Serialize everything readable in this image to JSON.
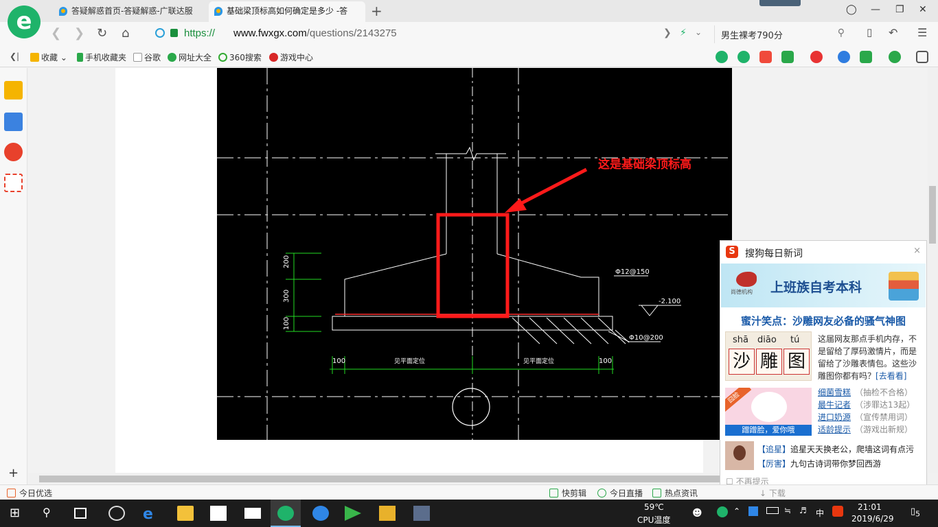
{
  "browser": {
    "tabs": [
      {
        "title": "答疑解惑首页-答疑解惑-广联达服",
        "active": false
      },
      {
        "title": "基础梁顶标高如何确定是多少 -答",
        "active": true
      }
    ],
    "url": {
      "protocol": "https://",
      "host": "www.fwxgx.com",
      "path": "/questions/2143275"
    },
    "search_query": "男生裸考790分",
    "bookmarks": [
      "收藏",
      "手机收藏夹",
      "谷歌",
      "网址大全",
      "360搜索",
      "游戏中心"
    ]
  },
  "drawing": {
    "annotation": "这是基础梁顶标高",
    "dims_left": [
      "200",
      "300",
      "100"
    ],
    "rebar_top": "Φ12@150",
    "rebar_bottom": "Φ10@200",
    "elevation": "-2.100",
    "dim_bottom": [
      "100",
      "见平面定位",
      "见平面定位",
      "100"
    ]
  },
  "popup": {
    "title": "搜狗每日新词",
    "close": "×",
    "banner_text": "上班族自考本科",
    "banner_brand": "尚德机构",
    "headline": "蜜汁笑点：沙雕网友必备的骚气神图",
    "pinyin": [
      "shā",
      "diāo",
      "tú"
    ],
    "hanzi": [
      "沙",
      "雕",
      "图"
    ],
    "body": "这届网友那点手机内存，不是留给了厚码激情片，而是留给了沙雕表情包。这些沙雕图你都有吗？",
    "more": "[去看看]",
    "img2_ribbon": "囧脸",
    "img2_caption": "蹭蹭脸，爱你哦",
    "list": [
      {
        "link": "细菌雪糕",
        "note": "（抽检不合格）"
      },
      {
        "link": "最牛记者",
        "note": "（涉罪达13起）"
      },
      {
        "link": "进口奶源",
        "note": "（宣传禁用词）"
      },
      {
        "link": "适龄提示",
        "note": "（游戏出新规）"
      }
    ],
    "news": [
      {
        "tag": "【追星】",
        "text": "追星天天换老公，爬墙这词有点污"
      },
      {
        "tag": "【厉害】",
        "text": "九句古诗词带你梦回西游"
      }
    ],
    "no_more": "不再提示"
  },
  "status": {
    "left": "今日优选",
    "items": [
      "快剪辑",
      "今日直播",
      "热点资讯"
    ],
    "download": "下载"
  },
  "taskbar": {
    "temp": "59℃",
    "temp_label": "CPU温度",
    "ime": "中",
    "time": "21:01",
    "date": "2019/6/29",
    "notif": "5"
  },
  "colors": {
    "accent_green": "#1fb36a",
    "link_blue": "#1a5aa8",
    "annot_red": "#ff1a1a"
  }
}
